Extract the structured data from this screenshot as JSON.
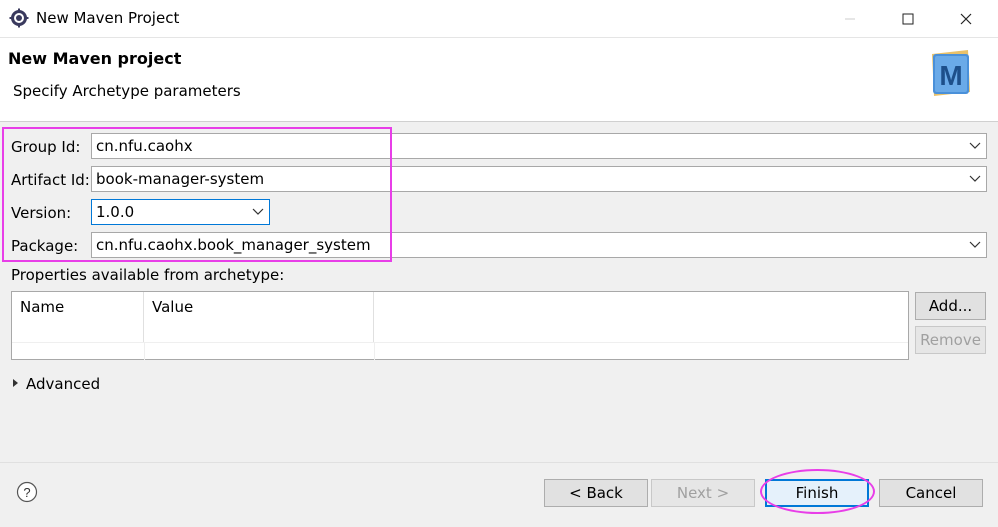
{
  "window": {
    "title": "New Maven Project",
    "app_icon": "eclipse-gear-icon",
    "controls": [
      "minimize-icon",
      "maximize-icon",
      "close-icon"
    ]
  },
  "header": {
    "title": "New Maven project",
    "subtitle": "Specify Archetype parameters",
    "logo": "maven-m-logo"
  },
  "form": {
    "group_id": {
      "label": "Group Id:",
      "value": "cn.nfu.caohx"
    },
    "artifact_id": {
      "label": "Artifact Id:",
      "value": "book-manager-system"
    },
    "version": {
      "label": "Version:",
      "value": "1.0.0"
    },
    "package": {
      "label": "Package:",
      "value": "cn.nfu.caohx.book_manager_system"
    }
  },
  "properties": {
    "label": "Properties available from archetype:",
    "columns": [
      "Name",
      "Value"
    ],
    "rows": [],
    "add_label": "Add...",
    "remove_label": "Remove"
  },
  "advanced": {
    "label": "Advanced",
    "expanded": false
  },
  "footer": {
    "help_icon": "help-question-icon",
    "back_label": "< Back",
    "next_label": "Next >",
    "finish_label": "Finish",
    "cancel_label": "Cancel"
  },
  "colors": {
    "highlight": "#e83ee8",
    "focus_border": "#0078d7"
  }
}
